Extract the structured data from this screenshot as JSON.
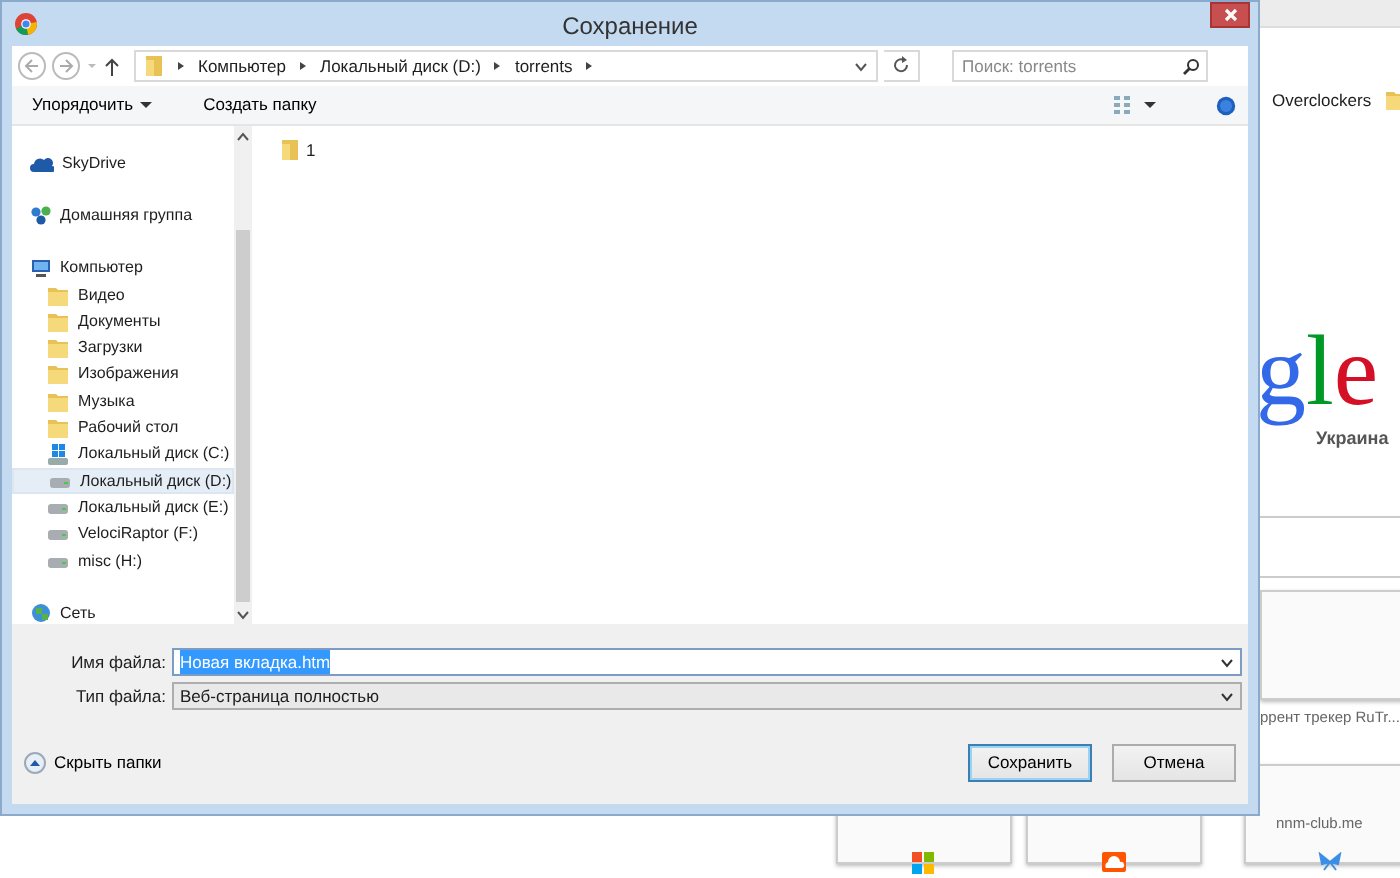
{
  "dialog": {
    "title": "Сохранение",
    "breadcrumb": [
      "Компьютер",
      "Локальный диск (D:)",
      "torrents"
    ],
    "search": {
      "placeholder": "Поиск: torrents"
    },
    "toolbar": {
      "organize": "Упорядочить",
      "new_folder": "Создать папку"
    },
    "nav_items": [
      {
        "label": "SkyDrive",
        "kind": "cloud",
        "selected": false
      },
      {
        "label": "Домашняя группа",
        "kind": "homegroup",
        "selected": false
      },
      {
        "label": "Компьютер",
        "kind": "computer",
        "selected": false,
        "children": [
          {
            "label": "Видео",
            "kind": "folder",
            "selected": false
          },
          {
            "label": "Документы",
            "kind": "folder",
            "selected": false
          },
          {
            "label": "Загрузки",
            "kind": "folder",
            "selected": false
          },
          {
            "label": "Изображения",
            "kind": "folder",
            "selected": false
          },
          {
            "label": "Музыка",
            "kind": "folder",
            "selected": false
          },
          {
            "label": "Рабочий стол",
            "kind": "folder",
            "selected": false
          },
          {
            "label": "Локальный диск (C:)",
            "kind": "system-drive",
            "selected": false
          },
          {
            "label": "Локальный диск (D:)",
            "kind": "drive",
            "selected": true
          },
          {
            "label": "Локальный диск (E:)",
            "kind": "drive",
            "selected": false
          },
          {
            "label": "VelociRaptor (F:)",
            "kind": "drive",
            "selected": false
          },
          {
            "label": "misc (H:)",
            "kind": "drive",
            "selected": false
          }
        ]
      },
      {
        "label": "Сеть",
        "kind": "network",
        "selected": false
      }
    ],
    "files": [
      {
        "label": "1"
      }
    ],
    "file_name": {
      "label": "Имя файла:",
      "value": "Новая вкладка.htm",
      "text_selected": true
    },
    "file_type": {
      "label": "Тип файла:",
      "value": "Веб-страница полностью"
    },
    "hide_folders": "Скрыть папки",
    "buttons": [
      {
        "label": "Сохранить",
        "default": true
      },
      {
        "label": "Отмена",
        "default": false
      }
    ]
  },
  "browser": {
    "bookmark": "Overclockers",
    "logo_letters": [
      {
        "text": "g",
        "color": "#3369e8"
      },
      {
        "text": "l",
        "color": "#009925"
      },
      {
        "text": "e",
        "color": "#d50f25"
      }
    ],
    "logo_subtitle": "Украина",
    "thumbnails": [
      {
        "caption": "ррент трекер RuTr...",
        "kind": "page"
      },
      {
        "kind": "windows"
      },
      {
        "kind": "soundcloud"
      },
      {
        "caption": "nnm-club.me",
        "kind": "blank"
      }
    ]
  }
}
